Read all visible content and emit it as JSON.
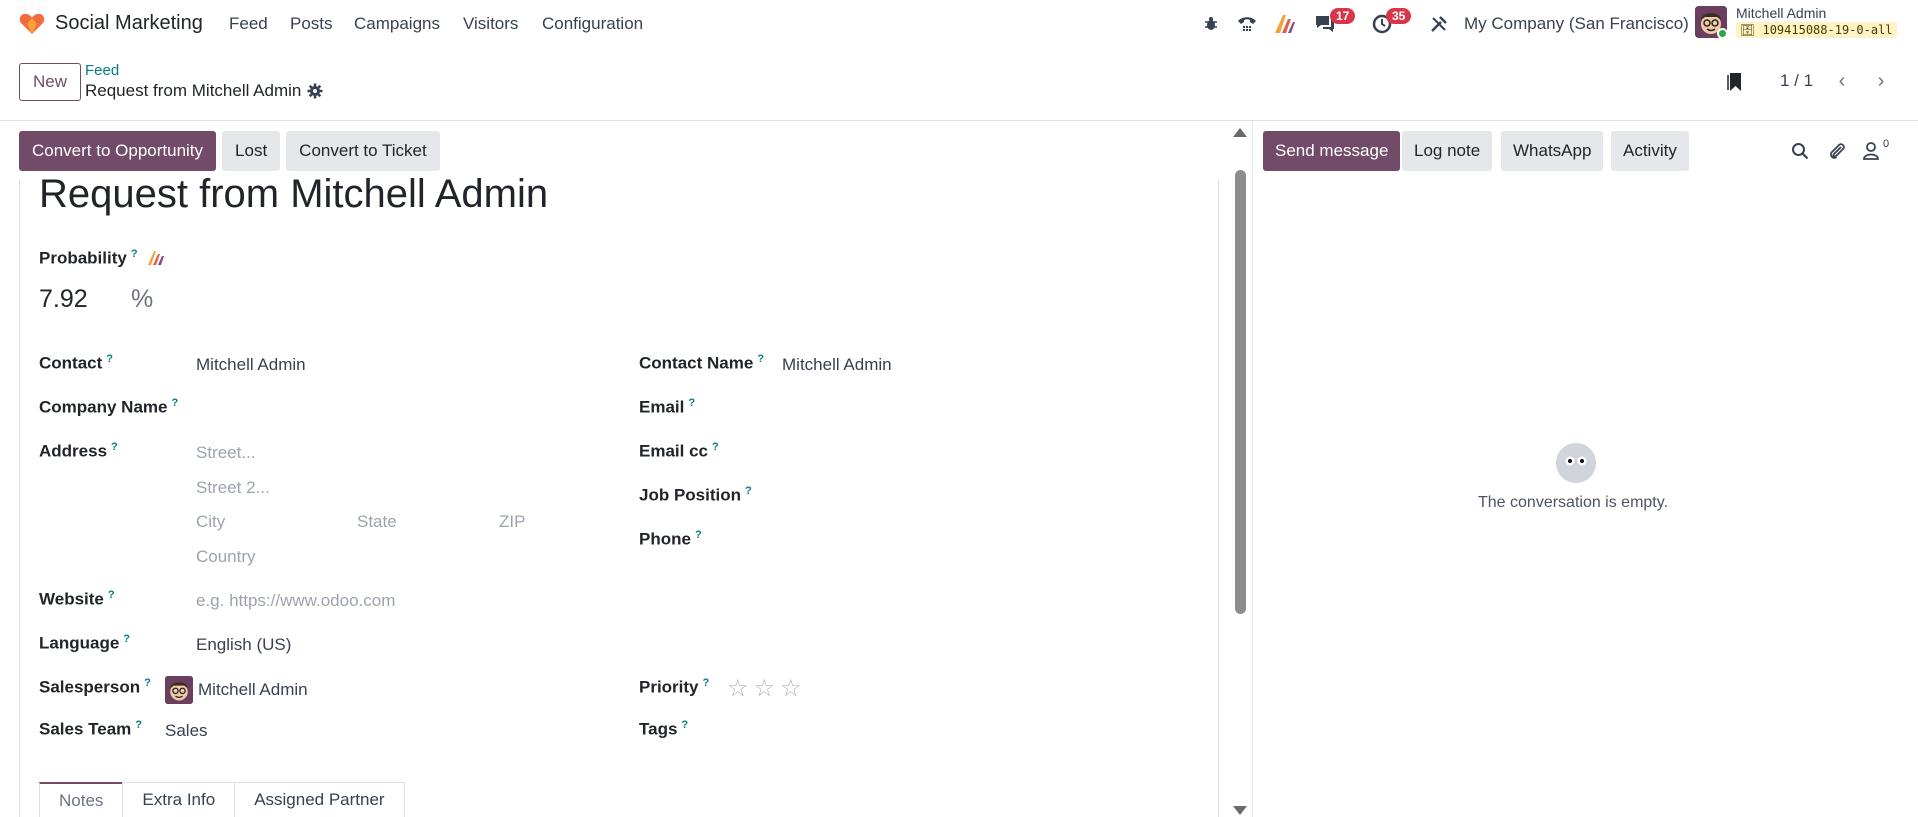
{
  "app": {
    "name": "Social Marketing",
    "menu": [
      "Feed",
      "Posts",
      "Campaigns",
      "Visitors",
      "Configuration"
    ]
  },
  "systray": {
    "messages_count": "17",
    "activities_count": "35",
    "company": "My Company (San Francisco)",
    "user_name": "Mitchell Admin",
    "database": "109415088-19-0-all"
  },
  "control_panel": {
    "new_label": "New",
    "breadcrumb_parent": "Feed",
    "breadcrumb_current": "Request from Mitchell Admin",
    "pager": "1 / 1"
  },
  "status_buttons": [
    "Convert to Opportunity",
    "Lost",
    "Convert to Ticket"
  ],
  "form": {
    "title": "Request from Mitchell Admin",
    "probability_label": "Probability",
    "probability_value": "7.92",
    "probability_unit": "%",
    "help_mark": "?",
    "left": {
      "contact_label": "Contact",
      "contact_value": "Mitchell Admin",
      "company_label": "Company Name",
      "address_label": "Address",
      "street_placeholder": "Street...",
      "street2_placeholder": "Street 2...",
      "city_placeholder": "City",
      "state_placeholder": "State",
      "zip_placeholder": "ZIP",
      "country_placeholder": "Country",
      "website_label": "Website",
      "website_placeholder": "e.g. https://www.odoo.com",
      "language_label": "Language",
      "language_value": "English (US)",
      "salesperson_label": "Salesperson",
      "salesperson_value": "Mitchell Admin",
      "sales_team_label": "Sales Team",
      "sales_team_value": "Sales"
    },
    "right": {
      "contact_name_label": "Contact Name",
      "contact_name_value": "Mitchell Admin",
      "email_label": "Email",
      "email_cc_label": "Email cc",
      "job_position_label": "Job Position",
      "phone_label": "Phone",
      "priority_label": "Priority",
      "priority_stars": 0,
      "tags_label": "Tags"
    },
    "tabs": [
      "Notes",
      "Extra Info",
      "Assigned Partner"
    ]
  },
  "chatter": {
    "buttons": [
      "Send message",
      "Log note",
      "WhatsApp",
      "Activity"
    ],
    "followers_count": "0",
    "empty_text": "The conversation is empty."
  },
  "colors": {
    "brand": "#714b67",
    "link": "#017e84",
    "badge": "#d9364a"
  }
}
